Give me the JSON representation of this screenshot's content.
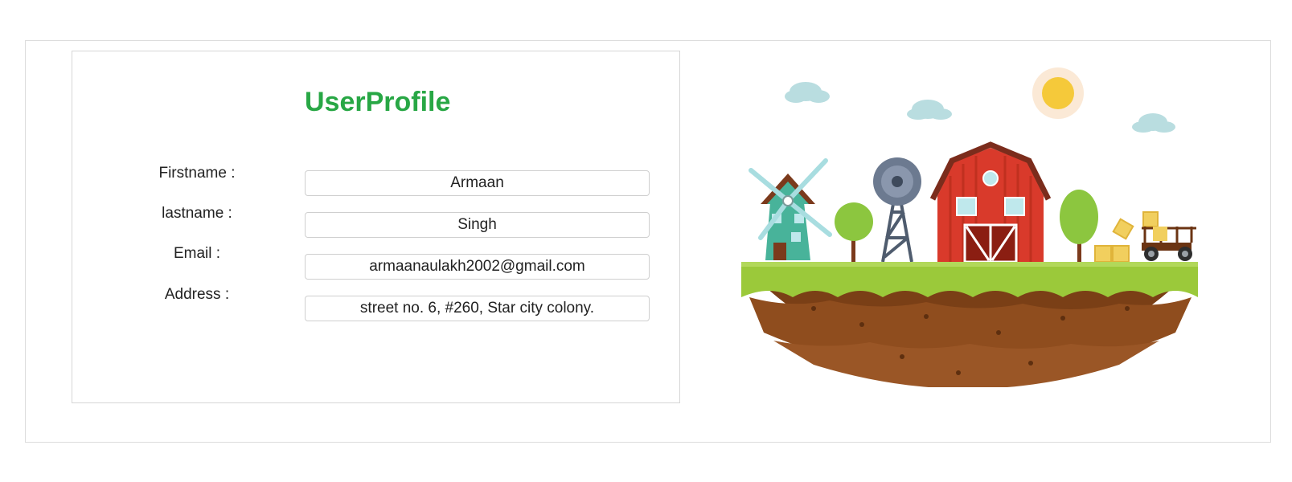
{
  "profile": {
    "title": "UserProfile",
    "fields": [
      {
        "label": "Firstname :",
        "value": "Armaan"
      },
      {
        "label": "lastname :",
        "value": "Singh"
      },
      {
        "label": "Email :",
        "value": "armaanaulakh2002@gmail.com"
      },
      {
        "label": "Address :",
        "value": "street no. 6, #260, Star city colony."
      }
    ]
  },
  "colors": {
    "title_green": "#28a745",
    "barn_red": "#d93a2b",
    "grass_green": "#9bc93a",
    "soil_brown": "#7a3f16"
  },
  "illustration": {
    "icons": [
      "sun-icon",
      "cloud-icon",
      "windmill-icon",
      "wind-pump-icon",
      "barn-icon",
      "tree-icon",
      "hay-bale-icon",
      "wagon-icon"
    ]
  }
}
